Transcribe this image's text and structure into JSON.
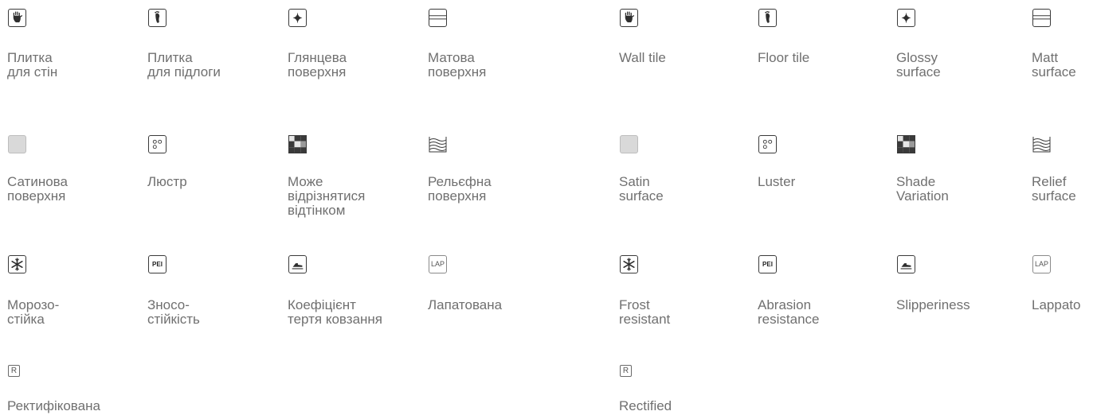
{
  "panels": {
    "uk": {
      "wall_tile": "Плитка\nдля стін",
      "floor_tile": "Плитка\nдля підлоги",
      "glossy": "Глянцева\nповерхня",
      "matt": "Матова\nповерхня",
      "satin": "Сатинова\nповерхня",
      "luster": "Люстр",
      "shade": "Може\nвідрізнятися\nвідтінком",
      "relief": "Рельєфна\nповерхня",
      "frost": "Морозо-\nстійка",
      "abrasion": "Зносо-\nстійкість",
      "slip": "Коефіцієнт\nтертя ковзання",
      "lappato": "Лапатована",
      "rectified": "Ректифікована"
    },
    "en": {
      "wall_tile": "Wall tile",
      "floor_tile": "Floor tile",
      "glossy": "Glossy\nsurface",
      "matt": "Matt\nsurface",
      "satin": "Satin\nsurface",
      "luster": "Luster",
      "shade": "Shade\nVariation",
      "relief": "Relief\nsurface",
      "frost": "Frost\nresistant",
      "abrasion": "Abrasion\nresistance",
      "slip": "Slipperiness",
      "lappato": "Lappato",
      "rectified": "Rectified"
    }
  },
  "icon_text": {
    "pei": "PEI",
    "lap": "LAP",
    "r": "R"
  },
  "colors": {
    "text": "#707070",
    "icon_stroke": "#3a3a3a",
    "satin_fill": "#d9d9d9"
  }
}
